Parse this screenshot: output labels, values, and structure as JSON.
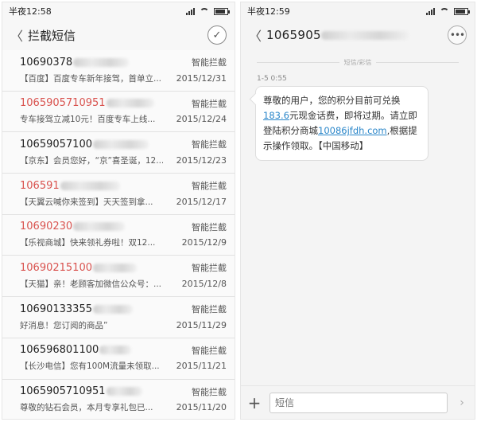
{
  "left": {
    "status_time": "半夜12:58",
    "title": "拦截短信",
    "items": [
      {
        "number": "10690378",
        "tag": "智能拦截",
        "preview": "【百度】百度专车新年接驾，首单立...",
        "date": "2015/12/31",
        "red": false
      },
      {
        "number": "1065905710951",
        "tag": "智能拦截",
        "preview": "专车接驾立减10元！百度专车上线...",
        "date": "2015/12/24",
        "red": true
      },
      {
        "number": "10659057100",
        "tag": "智能拦截",
        "preview": "【京东】会员您好，“京”喜圣诞，12...",
        "date": "2015/12/23",
        "red": false
      },
      {
        "number": "106591",
        "tag": "智能拦截",
        "preview": "【天翼云喊你来签到】天天签到拿...",
        "date": "2015/12/17",
        "red": true
      },
      {
        "number": "10690230",
        "tag": "智能拦截",
        "preview": "【乐视商城】快来领礼券啦！双12...",
        "date": "2015/12/9",
        "red": true
      },
      {
        "number": "10690215100",
        "tag": "智能拦截",
        "preview": "【天猫】亲！老顾客加微信公众号：...",
        "date": "2015/12/8",
        "red": true
      },
      {
        "number": "10690133355",
        "tag": "智能拦截",
        "preview": "好消息！您订阅的商品”",
        "date": "2015/11/29",
        "red": false
      },
      {
        "number": "106596801100",
        "tag": "智能拦截",
        "preview": "【长沙电信】您有100M流量未领取...",
        "date": "2015/11/21",
        "red": false
      },
      {
        "number": "1065905710951",
        "tag": "智能拦截",
        "preview": "尊敬的钻石会员，本月专享礼包已...",
        "date": "2015/11/20",
        "red": false
      }
    ]
  },
  "right": {
    "status_time": "半夜12:59",
    "title": "1065905",
    "divider": "短信/彩信",
    "time": "1-5 0:55",
    "message": {
      "part1": "尊敬的用户，您的积分目前可兑换",
      "link1": "183.6",
      "part2": "元现金话费，即将过期。请立即登陆积分商城",
      "link2": "10086jfdh.com",
      "part3": ",根据提示操作领取。【中国移动】"
    },
    "input_placeholder": "短信"
  },
  "icons": {
    "back": "back-arrow-icon",
    "check": "check-icon",
    "more": "more-icon",
    "plus": "plus-icon",
    "send": "send-icon"
  },
  "colors": {
    "red_number": "#d9534f",
    "link": "#2a86c9"
  }
}
